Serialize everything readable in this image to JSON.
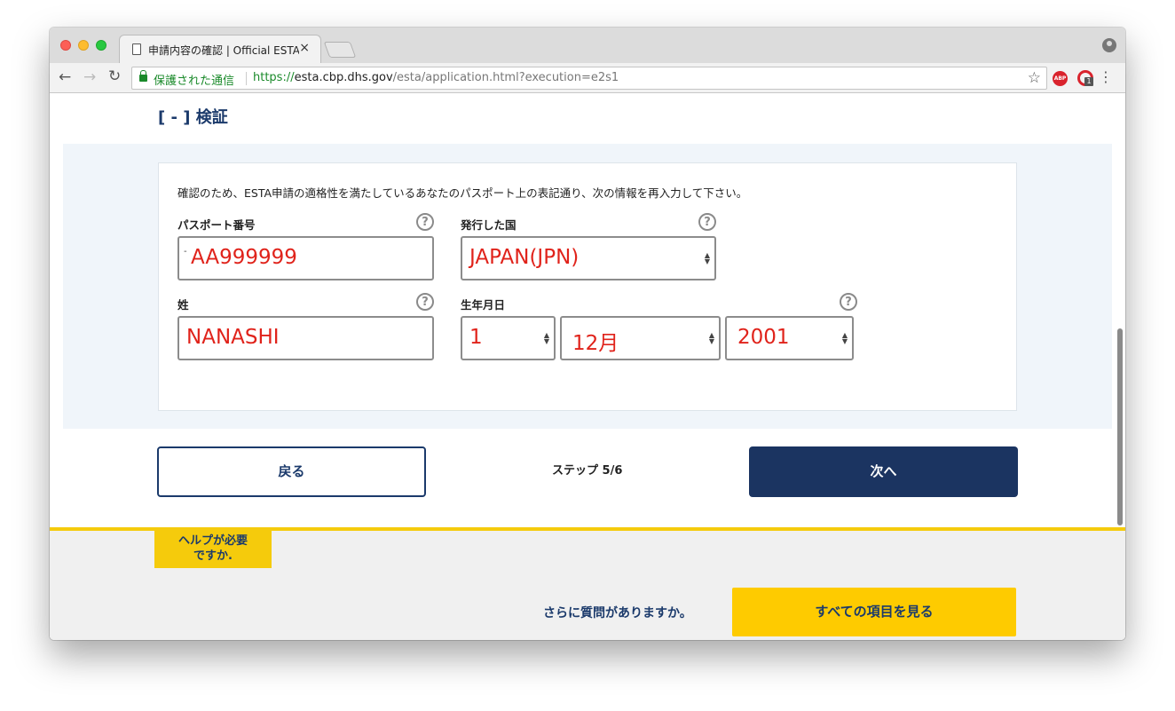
{
  "browser": {
    "tab_title": "申請内容の確認 | Official ESTA",
    "tab_close": "×",
    "secure_label": "保護された通信",
    "url_scheme": "https://",
    "url_host": "esta.cbp.dhs.gov",
    "url_path": "/esta/application.html?execution=e2s1",
    "abp_label": "ABP",
    "ext_badge": "1",
    "icons": [
      "back-arrow-icon",
      "forward-arrow-icon",
      "reload-icon",
      "lock-icon",
      "star-icon",
      "adblock-icon",
      "extension-icon",
      "menu-icon",
      "profile-icon",
      "document-icon"
    ]
  },
  "section": {
    "title": "[ - ] 検証"
  },
  "form": {
    "instruction": "確認のため、ESTA申請の適格性を満たしているあなたのパスポート上の表記通り、次の情報を再入力して下さい。",
    "passport_number": {
      "label": "パスポート番号",
      "value": "AA999999",
      "prefix": "-"
    },
    "issuing_country": {
      "label": "発行した国",
      "value": "JAPAN(JPN)"
    },
    "surname": {
      "label": "姓",
      "value": "NANASHI"
    },
    "birthdate": {
      "label": "生年月日",
      "day": "1",
      "month": "12月",
      "year": "2001"
    },
    "help_glyph": "?"
  },
  "nav": {
    "back_label": "戻る",
    "step_text": "ステップ 5/6",
    "next_label": "次へ"
  },
  "help": {
    "tag_line1": "ヘルプが必要",
    "tag_line2": "ですか.",
    "question": "さらに質問がありますか。",
    "all_items_label": "すべての項目を見る"
  },
  "colors": {
    "brand_navy": "#1b3461",
    "accent_yellow": "#fecb00",
    "input_text_red": "#e0231b",
    "secure_green": "#1a8a2a"
  }
}
